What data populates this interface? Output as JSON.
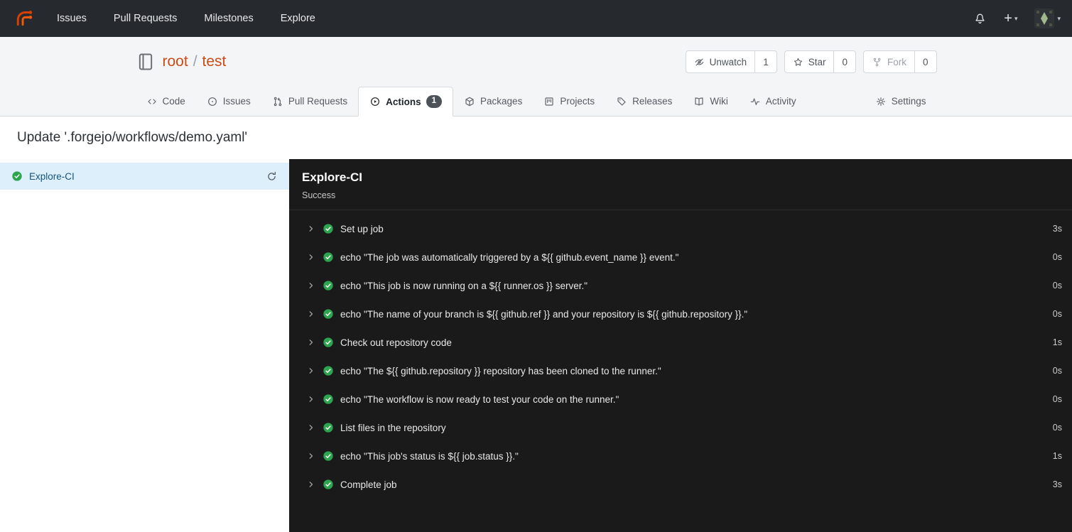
{
  "navbar": {
    "items": [
      "Issues",
      "Pull Requests",
      "Milestones",
      "Explore"
    ]
  },
  "repo": {
    "owner": "root",
    "sep": "/",
    "name": "test",
    "buttons": {
      "unwatch": {
        "label": "Unwatch",
        "count": "1"
      },
      "star": {
        "label": "Star",
        "count": "0"
      },
      "fork": {
        "label": "Fork",
        "count": "0"
      }
    }
  },
  "tabs": {
    "code": "Code",
    "issues": "Issues",
    "pulls": "Pull Requests",
    "actions": "Actions",
    "actions_badge": "1",
    "packages": "Packages",
    "projects": "Projects",
    "releases": "Releases",
    "wiki": "Wiki",
    "activity": "Activity",
    "settings": "Settings"
  },
  "run": {
    "title": "Update '.forgejo/workflows/demo.yaml'",
    "job_name": "Explore-CI",
    "panel_title": "Explore-CI",
    "panel_status": "Success",
    "steps": [
      {
        "name": "Set up job",
        "duration": "3s"
      },
      {
        "name": "echo \"The job was automatically triggered by a ${{ github.event_name }} event.\"",
        "duration": "0s"
      },
      {
        "name": "echo \"This job is now running on a ${{ runner.os }} server.\"",
        "duration": "0s"
      },
      {
        "name": "echo \"The name of your branch is ${{ github.ref }} and your repository is ${{ github.repository }}.\"",
        "duration": "0s"
      },
      {
        "name": "Check out repository code",
        "duration": "1s"
      },
      {
        "name": "echo \"The ${{ github.repository }} repository has been cloned to the runner.\"",
        "duration": "0s"
      },
      {
        "name": "echo \"The workflow is now ready to test your code on the runner.\"",
        "duration": "0s"
      },
      {
        "name": "List files in the repository",
        "duration": "0s"
      },
      {
        "name": "echo \"This job's status is ${{ job.status }}.\"",
        "duration": "1s"
      },
      {
        "name": "Complete job",
        "duration": "3s"
      }
    ]
  },
  "colors": {
    "accent": "#cb4b16",
    "success_green": "#2da44e",
    "navbar_bg": "#26292e",
    "panel_bg": "#1a1a1a",
    "job_active_bg": "#ddeffb"
  }
}
